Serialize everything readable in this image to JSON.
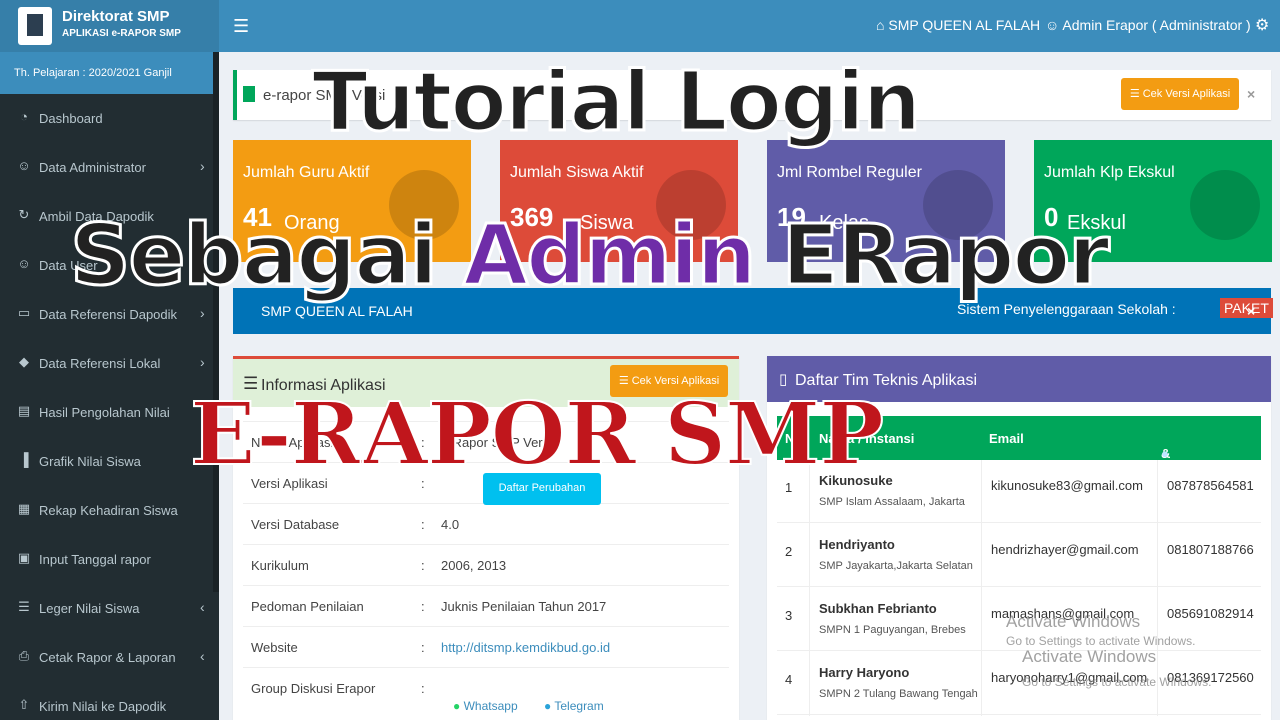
{
  "logo": {
    "title": "Direktorat SMP",
    "subtitle": "APLIKASI e-RAPOR SMP"
  },
  "sidebar": {
    "term": "Th. Pelajaran : 2020/2021 Ganjil",
    "items": [
      {
        "label": "Dashboard",
        "icon": "dashboard-icon",
        "glyph": "◔",
        "chevron": ""
      },
      {
        "label": "Data Administrator",
        "icon": "users-icon",
        "glyph": "☺",
        "chevron": "›"
      },
      {
        "label": "Ambil Data Dapodik",
        "icon": "refresh-icon",
        "glyph": "↻",
        "chevron": ""
      },
      {
        "label": "Data User",
        "icon": "users-icon",
        "glyph": "☺",
        "chevron": ""
      },
      {
        "label": "Data Referensi Dapodik",
        "icon": "monitor-icon",
        "glyph": "▭",
        "chevron": "›"
      },
      {
        "label": "Data Referensi Lokal",
        "icon": "tag-icon",
        "glyph": "◆",
        "chevron": "›"
      },
      {
        "label": "Hasil Pengolahan Nilai",
        "icon": "book-icon",
        "glyph": "▤",
        "chevron": ""
      },
      {
        "label": "Grafik Nilai Siswa",
        "icon": "chart-icon",
        "glyph": "▐",
        "chevron": ""
      },
      {
        "label": "Rekap Kehadiran Siswa",
        "icon": "calculator-icon",
        "glyph": "▦",
        "chevron": ""
      },
      {
        "label": "Input Tanggal rapor",
        "icon": "calendar-icon",
        "glyph": "▣",
        "chevron": ""
      },
      {
        "label": "Leger Nilai Siswa",
        "icon": "list-icon",
        "glyph": "☰",
        "chevron": "‹"
      },
      {
        "label": "Cetak Rapor & Laporan",
        "icon": "print-icon",
        "glyph": "⎙",
        "chevron": "‹"
      },
      {
        "label": "Kirim Nilai ke Dapodik",
        "icon": "upload-icon",
        "glyph": "⇧",
        "chevron": ""
      }
    ]
  },
  "topbar": {
    "menu_icon": "☰",
    "school": "SMP QUEEN AL FALAH",
    "user": "Admin Erapor ( Administrator )",
    "gear": "⚙"
  },
  "notice": {
    "title": "e-rapor SMP Versi",
    "button": "Cek Versi Aplikasi",
    "close": "×"
  },
  "stats": [
    {
      "label": "Jumlah Guru Aktif",
      "value": "41",
      "unit": "Orang",
      "color": "#f39c12"
    },
    {
      "label": "Jumlah Siswa Aktif",
      "value": "369",
      "unit": "Siswa",
      "color": "#dd4b39"
    },
    {
      "label": "Jml Rombel Reguler",
      "value": "19",
      "unit": "Kelas",
      "color": "#605ca8"
    },
    {
      "label": "Jumlah Klp Ekskul",
      "value": "0",
      "unit": "Ekskul",
      "color": "#00a65a"
    }
  ],
  "school_bar": {
    "name": "SMP QUEEN AL FALAH",
    "system_label": "Sistem Penyelenggaraan Sekolah :",
    "badge": "PAKET",
    "close": "×"
  },
  "info": {
    "title": "Informasi Aplikasi",
    "button": "Cek Versi Aplikasi",
    "changes_button": "Daftar Perubahan",
    "rows": [
      {
        "key": "Nama Aplikasi",
        "value": "e-Rapor SMP Versi"
      },
      {
        "key": "Versi Aplikasi",
        "value": ""
      },
      {
        "key": "Versi Database",
        "value": "4.0"
      },
      {
        "key": "Kurikulum",
        "value": "2006, 2013"
      },
      {
        "key": "Pedoman Penilaian",
        "value": "Juknis Penilaian Tahun 2017"
      },
      {
        "key": "Website",
        "value": "http://ditsmp.kemdikbud.go.id"
      },
      {
        "key": "Group Diskusi Erapor",
        "value": ""
      }
    ],
    "whatsapp": "Whatsapp",
    "telegram": "Telegram",
    "colon": ":"
  },
  "tim": {
    "title": "Daftar Tim Teknis Aplikasi",
    "headers": {
      "no": "No",
      "nama": "Nama / Instansi",
      "email": "Email",
      "contact": "&"
    },
    "rows": [
      {
        "no": "1",
        "name": "Kikunosuke",
        "school": "SMP Islam Assalaam, Jakarta",
        "email": "kikunosuke83@gmail.com",
        "phone": "087878564581"
      },
      {
        "no": "2",
        "name": "Hendriyanto",
        "school": "SMP Jayakarta,Jakarta Selatan",
        "email": "hendrizhayer@gmail.com",
        "phone": "081807188766"
      },
      {
        "no": "3",
        "name": "Subkhan Febrianto",
        "school": "SMPN 1 Paguyangan, Brebes",
        "email": "mamashans@gmail.com",
        "phone": "085691082914"
      },
      {
        "no": "4",
        "name": "Harry Haryono",
        "school": "SMPN 2 Tulang Bawang Tengah",
        "email": "haryonoharry1@gmail.com",
        "phone": "081369172560"
      }
    ]
  },
  "watermark": {
    "line1": "Activate Windows",
    "line2": "Go to Settings to activate Windows.",
    "line3": "Activate Windows",
    "line4": "Go to Settings to activate Windows."
  },
  "overlay": {
    "line1": "Tutorial Login",
    "line2_a": "Sebagai ",
    "line2_b": "Admin",
    "line2_c": " ERapor",
    "line3": "E-RAPOR SMP"
  }
}
